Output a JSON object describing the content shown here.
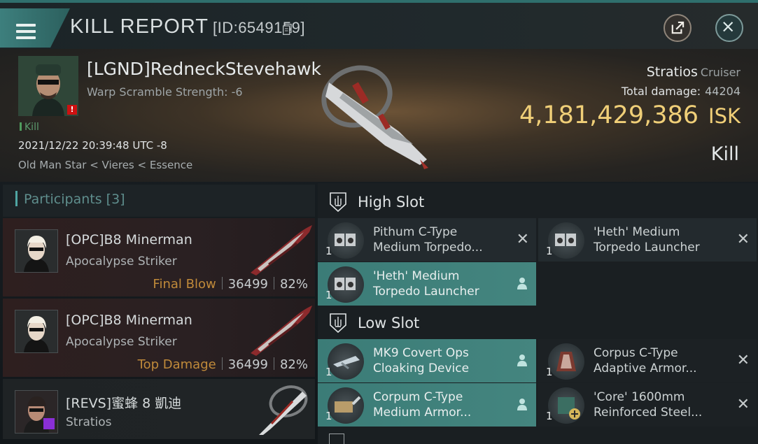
{
  "header": {
    "title": "KILL REPORT",
    "id_text": "[ID:6549159]",
    "menu_icon": "hamburger-icon",
    "share_icon": "share-icon",
    "close_icon": "close-icon"
  },
  "victim": {
    "pilot": "[LGND]RedneckStevehawk",
    "warp_scramble": "Warp Scramble Strength: -6",
    "status_tag": "Kill",
    "datetime": "2021/12/22 20:39:48 UTC -8",
    "location": "Old Man Star < Vieres < Essence",
    "ship_name": "Stratios",
    "ship_class": "Cruiser",
    "total_damage_label": "Total damage:",
    "total_damage": "44204",
    "isk_value": "4,181,429,386",
    "isk_unit": "ISK",
    "result": "Kill"
  },
  "participants": {
    "label": "Participants",
    "count": "[3]",
    "rows": [
      {
        "name": "[OPC]B8 Minerman",
        "ship": "Apocalypse Striker",
        "tag": "Final Blow",
        "damage": "36499",
        "percent": "82%"
      },
      {
        "name": "[OPC]B8 Minerman",
        "ship": "Apocalypse Striker",
        "tag": "Top Damage",
        "damage": "36499",
        "percent": "82%"
      },
      {
        "name": "[REVS]蜜蜂 8 凱迪",
        "ship": "Stratios"
      }
    ]
  },
  "slots": {
    "high": {
      "label": "High Slot",
      "items": [
        {
          "qty": "1",
          "name1": "Pithum C-Type",
          "name2": "Medium Torpedo..."
        },
        {
          "qty": "1",
          "name1": "'Heth' Medium",
          "name2": "Torpedo Launcher"
        },
        {
          "qty": "1",
          "name1": "'Heth' Medium",
          "name2": "Torpedo Launcher"
        }
      ]
    },
    "low": {
      "label": "Low Slot",
      "items": [
        {
          "qty": "1",
          "name1": "MK9 Covert Ops",
          "name2": "Cloaking Device"
        },
        {
          "qty": "1",
          "name1": "Corpus C-Type",
          "name2": "Adaptive Armor..."
        },
        {
          "qty": "1",
          "name1": "Corpum C-Type",
          "name2": "Medium Armor..."
        },
        {
          "qty": "1",
          "name1": "'Core' 1600mm",
          "name2": "Reinforced Steel..."
        }
      ]
    }
  },
  "colors": {
    "accent": "#3d7f7d",
    "isk": "#f0cf78",
    "tag": "#c08a3a",
    "highlight": "#44857f"
  }
}
